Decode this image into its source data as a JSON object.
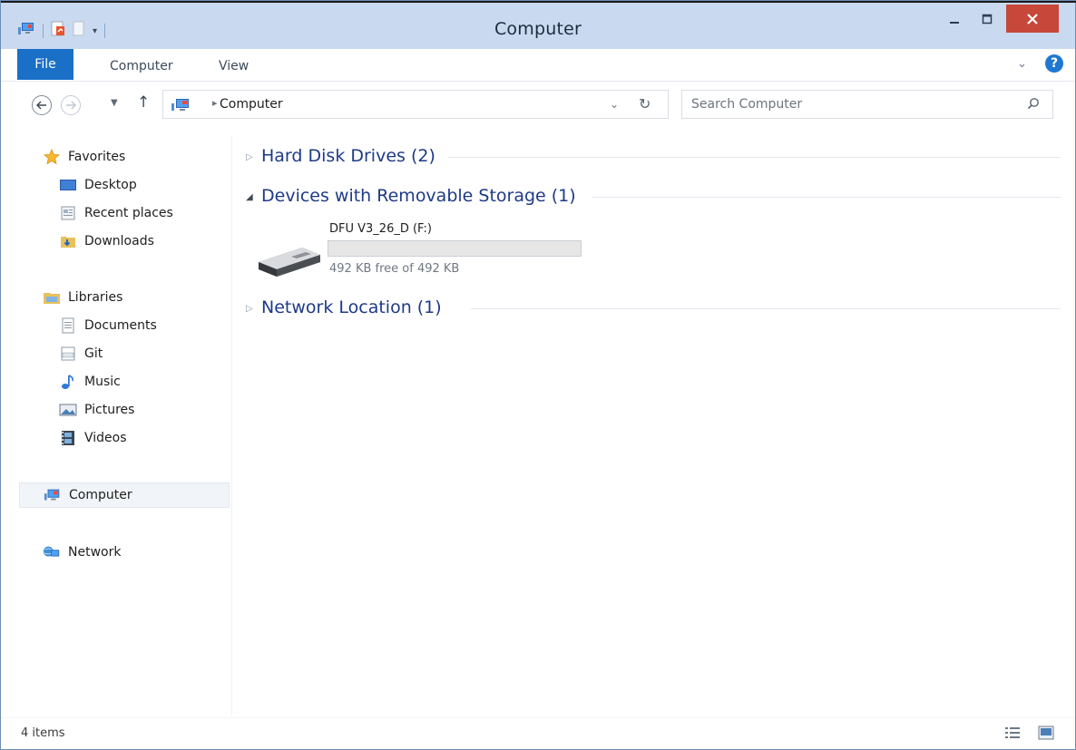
{
  "window": {
    "title": "Computer"
  },
  "ribbon": {
    "tabs": [
      {
        "label": "File"
      },
      {
        "label": "Computer"
      },
      {
        "label": "View"
      }
    ],
    "help": "?"
  },
  "address": {
    "crumbs": [
      "Computer"
    ],
    "search_placeholder": "Search Computer"
  },
  "sidebar": {
    "favorites": {
      "label": "Favorites",
      "items": [
        {
          "label": "Desktop"
        },
        {
          "label": "Recent places"
        },
        {
          "label": "Downloads"
        }
      ]
    },
    "libraries": {
      "label": "Libraries",
      "items": [
        {
          "label": "Documents"
        },
        {
          "label": "Git"
        },
        {
          "label": "Music"
        },
        {
          "label": "Pictures"
        },
        {
          "label": "Videos"
        }
      ]
    },
    "computer": {
      "label": "Computer",
      "selected": true
    },
    "network": {
      "label": "Network"
    }
  },
  "content": {
    "groups": [
      {
        "title": "Hard Disk Drives (2)",
        "expanded": false
      },
      {
        "title": "Devices with Removable Storage (1)",
        "expanded": true
      },
      {
        "title": "Network Location (1)",
        "expanded": false
      }
    ],
    "drive": {
      "name": "DFU V3_26_D (F:)",
      "free_text": "492 KB free of 492 KB",
      "used_fraction": 0
    }
  },
  "status": {
    "item_count": "4 items"
  },
  "colors": {
    "accent": "#1a6fc7",
    "titlebar": "#c9daf0",
    "close": "#c7473a",
    "group_title": "#1e3a87"
  }
}
